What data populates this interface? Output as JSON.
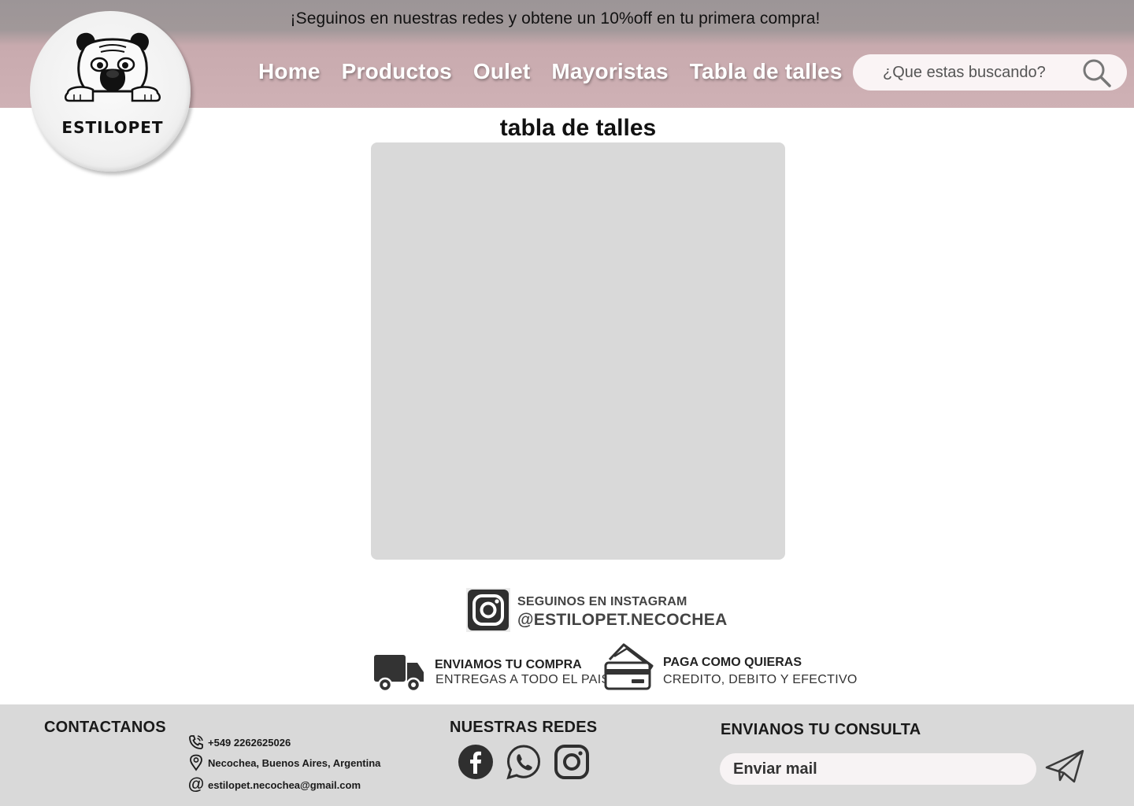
{
  "header": {
    "promo_text": "¡Seguinos en nuestras redes y obtene un 10%off en tu primera compra!",
    "logo_text": "ESTILOPET",
    "nav": [
      {
        "label": "Home"
      },
      {
        "label": "Productos"
      },
      {
        "label": "Oulet"
      },
      {
        "label": "Mayoristas"
      },
      {
        "label": "Tabla de talles"
      }
    ],
    "search": {
      "placeholder": "¿Que estas buscando?",
      "icon": "search-icon"
    }
  },
  "main": {
    "title": "tabla de talles",
    "table_placeholder_color": "#d9d9d9"
  },
  "promos": {
    "instagram": {
      "line1": "SEGUINOS EN INSTAGRAM",
      "line2": "@ESTILOPET.NECOCHEA",
      "icon": "instagram-icon"
    },
    "shipping": {
      "line1": "ENVIAMOS TU COMPRA",
      "line2": "ENTREGAS A TODO EL PAIS",
      "icon": "truck-icon"
    },
    "payment": {
      "line1": "PAGA COMO QUIERAS",
      "line2": "CREDITO, DEBITO Y EFECTIVO",
      "icon": "credit-card-icon"
    }
  },
  "footer": {
    "contact_heading": "CONTACTANOS",
    "contact": {
      "phone": "+549 2262625026",
      "address": "Necochea, Buenos Aires, Argentina",
      "email": "estilopet.necochea@gmail.com"
    },
    "social_heading": "NUESTRAS REDES",
    "social_icons": [
      "facebook-icon",
      "whatsapp-icon",
      "instagram-icon"
    ],
    "consult_heading": "ENVIANOS TU CONSULTA",
    "mail_placeholder": "Enviar mail",
    "send_icon": "paper-plane-icon"
  },
  "colors": {
    "header_top": "#a19899",
    "header_bottom": "#cfb1b5",
    "footer_bg": "#d9d9d9",
    "search_bg": "#faf4f5"
  }
}
